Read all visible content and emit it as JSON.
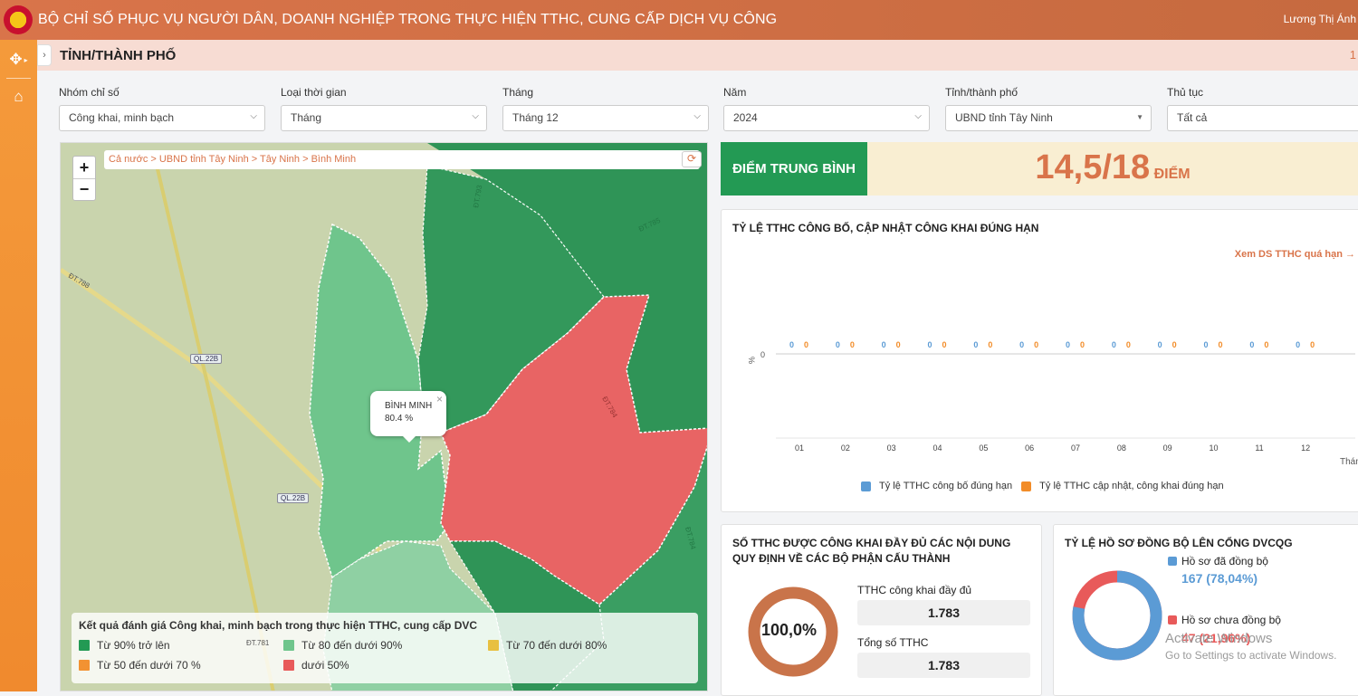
{
  "header": {
    "title": "BỘ CHỈ SỐ PHỤC VỤ NGƯỜI DÂN, DOANH NGHIỆP TRONG THỰC HIỆN TTHC, CUNG CẤP DỊCH VỤ CÔNG",
    "user": "Lương Thị Ánh"
  },
  "sidebar": {
    "items": [
      {
        "icon": "move-icon"
      },
      {
        "icon": "home-icon"
      }
    ]
  },
  "page": {
    "title": "TỈNH/THÀNH PHỐ",
    "right_number": "1"
  },
  "filters": [
    {
      "label": "Nhóm chỉ số",
      "value": "Công khai, minh bạch"
    },
    {
      "label": "Loại thời gian",
      "value": "Tháng"
    },
    {
      "label": "Tháng",
      "value": "Tháng 12"
    },
    {
      "label": "Năm",
      "value": "2024"
    },
    {
      "label": "Tỉnh/thành phố",
      "value": "UBND tỉnh Tây Ninh"
    },
    {
      "label": "Thủ tục",
      "value": "Tất cả"
    }
  ],
  "map": {
    "breadcrumb": "Cả nước > UBND tỉnh Tây Ninh > Tây Ninh > Bình Minh",
    "zoom_in": "+",
    "zoom_out": "−",
    "popup": {
      "name": "BÌNH MINH",
      "value": "80.4 %"
    },
    "road_labels": [
      "ĐT.788",
      "QL.22B",
      "QL.22B",
      "ĐT.793",
      "ĐT.785",
      "ĐT.784",
      "ĐT.784",
      "ĐT.781"
    ],
    "legend": {
      "title": "Kết quả đánh giá Công khai, minh bạch trong thực hiện TTHC, cung cấp DVC",
      "items": [
        {
          "label": "Từ 90% trở lên",
          "color": "#239a54"
        },
        {
          "label": "Từ 80 đến dưới 90%",
          "color": "#6fc58c"
        },
        {
          "label": "Từ 70 đến dưới 80%",
          "color": "#e8c040"
        },
        {
          "label": "Từ 50 đến dưới 70 %",
          "color": "#f29232"
        },
        {
          "label": "dưới 50%",
          "color": "#e85a5a"
        }
      ]
    },
    "colors": {
      "dark_green": "#3a9e62",
      "light_green": "#6fc58c",
      "red": "#e86464",
      "land": "#c9d4ad"
    }
  },
  "score": {
    "label": "ĐIỂM TRUNG BÌNH",
    "value": "14,5/18",
    "unit": "ĐIỂM"
  },
  "bar_chart": {
    "title": "TỶ LỆ TTHC CÔNG BỐ, CẬP NHẬT CÔNG KHAI ĐÚNG HẠN",
    "link": "Xem DS TTHC quá hạn →",
    "y_axis_label": "%",
    "y_tick": "0",
    "x_axis_label": "Tháng",
    "series_colors": [
      "#5b9bd5",
      "#f28c28"
    ]
  },
  "chart_data": {
    "type": "bar",
    "title": "TỶ LỆ TTHC CÔNG BỐ, CẬP NHẬT CÔNG KHAI ĐÚNG HẠN",
    "xlabel": "Tháng",
    "ylabel": "%",
    "categories": [
      "01",
      "02",
      "03",
      "04",
      "05",
      "06",
      "07",
      "08",
      "09",
      "10",
      "11",
      "12"
    ],
    "series": [
      {
        "name": "Tỷ lệ TTHC công bố đúng hạn",
        "values": [
          0,
          0,
          0,
          0,
          0,
          0,
          0,
          0,
          0,
          0,
          0,
          0
        ]
      },
      {
        "name": "Tỷ lệ TTHC cập nhật, công khai đúng hạn",
        "values": [
          0,
          0,
          0,
          0,
          0,
          0,
          0,
          0,
          0,
          0,
          0,
          0
        ]
      }
    ],
    "legend": "bottom"
  },
  "card_public": {
    "title_line1": "SỐ TTHC ĐƯỢC CÔNG KHAI ĐẦY ĐỦ CÁC NỘI DUNG",
    "title_line2": "QUY ĐỊNH VỀ CÁC BỘ PHẬN CẤU THÀNH",
    "percent": "100,0%",
    "percent_value": 1.0,
    "ring_color": "#c9744a",
    "label1": "TTHC công khai đầy đủ",
    "value1": "1.783",
    "label2": "Tổng số TTHC",
    "value2": "1.783"
  },
  "card_sync": {
    "title": "TỶ LỆ HỒ SƠ ĐỒNG BỘ LÊN CỔNG DVCQG",
    "synced_label": "Hồ sơ đã đồng bộ",
    "synced_value": "167 (78,04%)",
    "synced_fraction": 0.7804,
    "unsynced_label": "Hồ sơ chưa đồng bộ",
    "unsynced_value": "47 (21,96%)",
    "colors": {
      "synced": "#5b9bd5",
      "unsynced": "#e85a5a"
    }
  },
  "watermark": {
    "line1": "Activate Windows",
    "line2": "Go to Settings to activate Windows."
  }
}
